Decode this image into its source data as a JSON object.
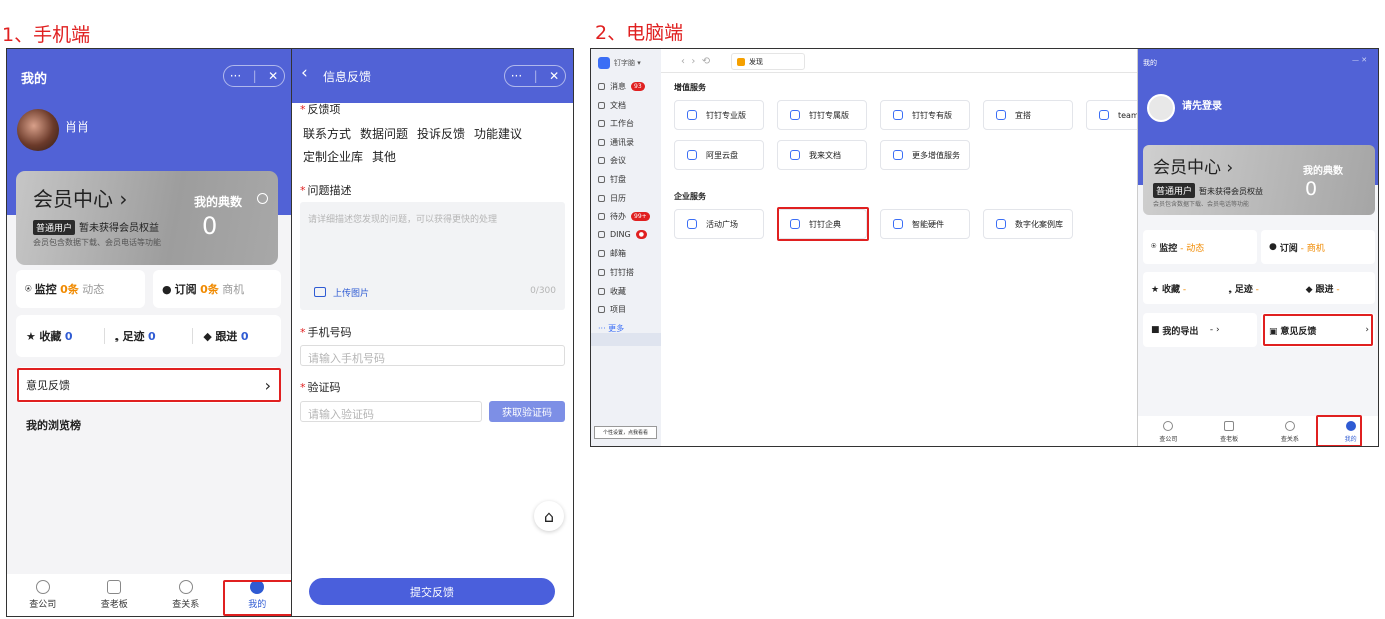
{
  "headings": {
    "phone": "1、手机端",
    "desktop": "2、电脑端"
  },
  "phone_left": {
    "title": "我的",
    "more_label": "···",
    "close_label": "✕",
    "username": "肖肖",
    "vip": {
      "title": "会员中心",
      "chevron": "›",
      "tag": "普通用户",
      "status": "暂未获得会员权益",
      "desc": "会员包含数据下载、会员电话等功能",
      "points_label": "我的典数",
      "points_value": "0"
    },
    "monitor": {
      "label": "监控",
      "count": "0条",
      "suffix": "动态"
    },
    "subscribe": {
      "label": "订阅",
      "count": "0条",
      "suffix": "商机"
    },
    "stats": [
      {
        "label": "收藏",
        "value": "0"
      },
      {
        "label": "足迹",
        "value": "0"
      },
      {
        "label": "跟进",
        "value": "0"
      }
    ],
    "feedback": {
      "label": "意见反馈",
      "arrow": "›"
    },
    "browse_rank": "我的浏览榜",
    "tabs": [
      "查公司",
      "查老板",
      "查关系",
      "我的"
    ]
  },
  "phone_mid": {
    "back": "‹",
    "title": "信息反馈",
    "more_label": "···",
    "close_label": "✕",
    "feedback_items_label": "反馈项",
    "chips_row1": [
      "联系方式",
      "数据问题",
      "投诉反馈",
      "功能建议"
    ],
    "chips_row2": [
      "定制企业库",
      "其他"
    ],
    "desc_label": "问题描述",
    "desc_placeholder": "请详细描述您发现的问题，可以获得更快的处理",
    "upload_label": "上传图片",
    "counter": "0/300",
    "phone_label": "手机号码",
    "phone_placeholder": "请输入手机号码",
    "code_label": "验证码",
    "code_placeholder": "请输入验证码",
    "get_code": "获取验证码",
    "home_icon": "⌂",
    "submit": "提交反馈"
  },
  "desktop": {
    "org_name": "钉字脑 ▾",
    "tab_label": "发现",
    "sidebar": [
      {
        "label": "消息",
        "badge": "93"
      },
      {
        "label": "文档",
        "badge": ""
      },
      {
        "label": "工作台",
        "badge": ""
      },
      {
        "label": "通讯录",
        "badge": ""
      },
      {
        "label": "会议",
        "badge": ""
      },
      {
        "label": "钉盘",
        "badge": ""
      },
      {
        "label": "日历",
        "badge": ""
      },
      {
        "label": "待办",
        "badge": "99+"
      },
      {
        "label": "DING",
        "badge": "●"
      },
      {
        "label": "邮箱",
        "badge": ""
      },
      {
        "label": "钉钉搭",
        "badge": ""
      },
      {
        "label": "收藏",
        "badge": ""
      },
      {
        "label": "项目",
        "badge": ""
      },
      {
        "label": "··· 更多",
        "badge": ""
      }
    ],
    "sidebar_bottom": "个性设置，点我看看",
    "value_services_title": "增值服务",
    "value_services": [
      "钉钉专业版",
      "钉钉专属版",
      "钉钉专有版",
      "宜搭",
      "team",
      "阿里云盘",
      "我来文档",
      "更多增值服务"
    ],
    "enterprise_services_title": "企业服务",
    "enterprise_services": [
      "活动广场",
      "钉钉企典",
      "智能硬件",
      "数字化案例库"
    ],
    "drawer": {
      "title": "我的",
      "window_controls": "— ✕",
      "login": "请先登录",
      "vip_title": "会员中心",
      "vip_chevron": "›",
      "vip_tag": "普通用户",
      "vip_status": "暂未获得会员权益",
      "vip_desc": "会员包含数据下载、会员电话等功能",
      "points_label": "我的典数",
      "points_value": "0",
      "monitor": {
        "label": "监控",
        "suffix": "- 动态"
      },
      "subscribe": {
        "label": "订阅",
        "suffix": "- 商机"
      },
      "stats": [
        {
          "label": "收藏",
          "suffix": "-"
        },
        {
          "label": "足迹",
          "suffix": "-"
        },
        {
          "label": "跟进",
          "suffix": "-"
        }
      ],
      "export": {
        "label": "我的导出",
        "suffix": "- ›"
      },
      "feedback": {
        "label": "意见反馈",
        "arrow": "›"
      },
      "tabs": [
        "查公司",
        "查老板",
        "查关系",
        "我的"
      ]
    }
  },
  "colors": {
    "brand": "#5162d6",
    "highlight": "#e02020",
    "submit": "#4a5fdc"
  }
}
